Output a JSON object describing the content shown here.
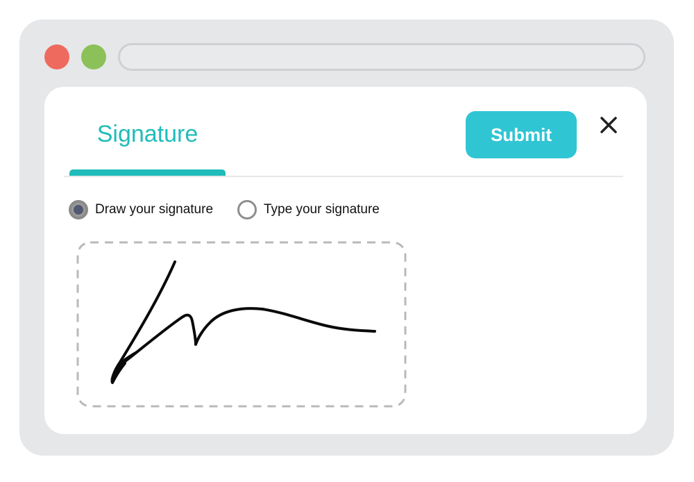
{
  "window": {
    "traffic_lights": [
      {
        "name": "close",
        "color": "#ef6a5e"
      },
      {
        "name": "zoom",
        "color": "#8bc158"
      }
    ],
    "address_bar": {
      "value": ""
    }
  },
  "dialog": {
    "tab_label": "Signature",
    "submit_label": "Submit",
    "close_icon": "close-icon",
    "options": [
      {
        "label": "Draw your signature",
        "selected": true
      },
      {
        "label": "Type your signature",
        "selected": false
      }
    ],
    "signature_pad": {
      "mode": "draw",
      "has_signature": true
    }
  },
  "colors": {
    "accent": "#1fbcb9",
    "submit_bg": "#30c5d3",
    "frame_bg": "#e6e7e9",
    "ink": "#0a0a0a"
  }
}
